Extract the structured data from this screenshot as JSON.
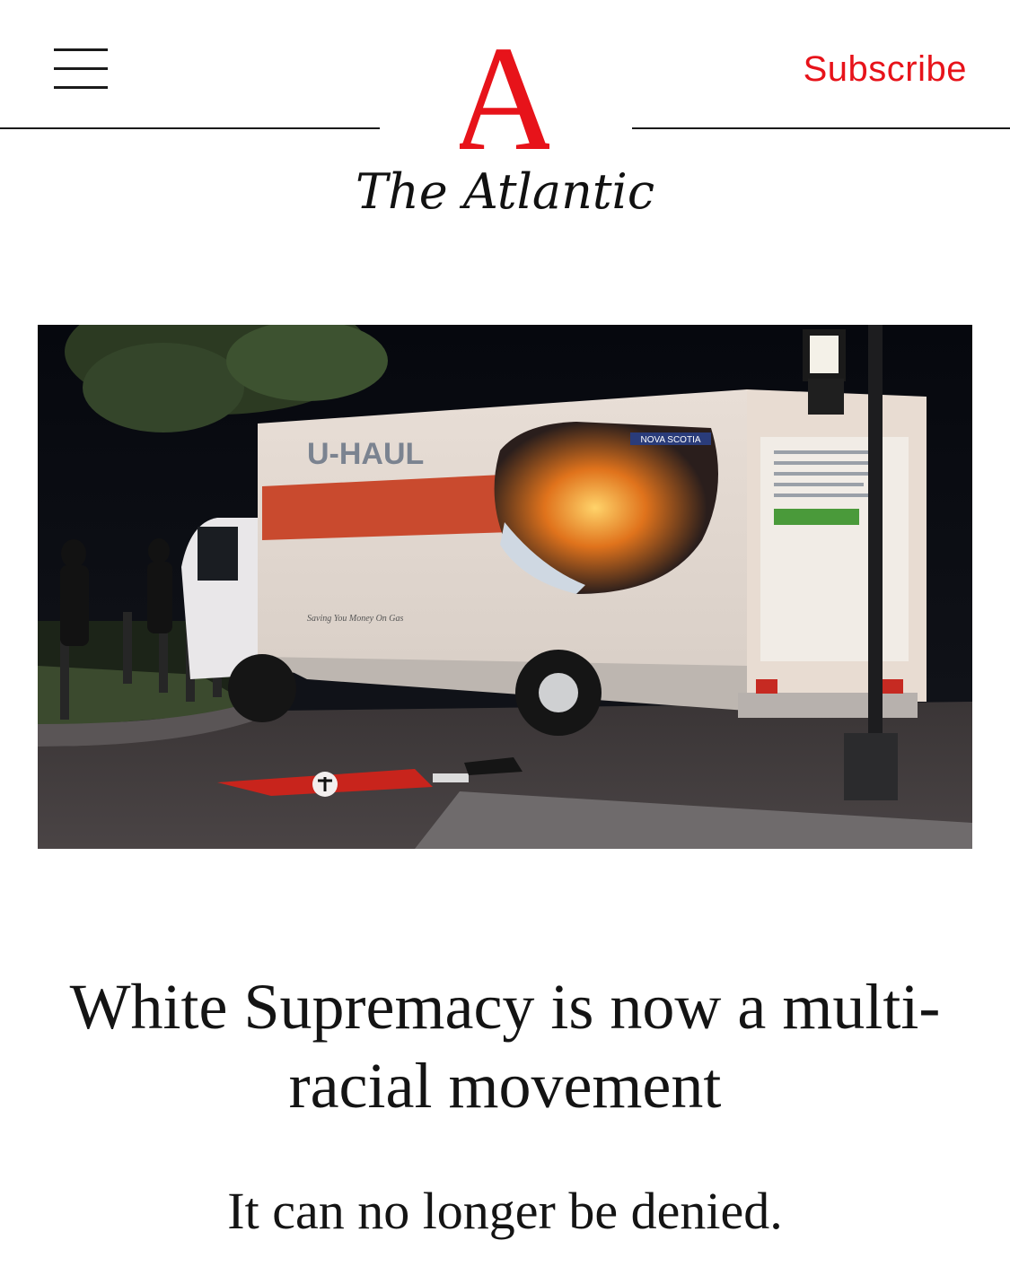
{
  "header": {
    "menu_icon": "hamburger-menu-icon",
    "logo_letter": "A",
    "brand_name": "The Atlantic",
    "subscribe_label": "Subscribe",
    "accent_color": "#e7131a"
  },
  "hero_image": {
    "truck_brand": "U-HAUL",
    "truck_panel_label": "NOVA SCOTIA",
    "truck_slogan": "Saving You Money On Gas"
  },
  "article": {
    "headline": "White Supremacy is now a multi-racial movement",
    "dek": "It can no longer be denied."
  }
}
